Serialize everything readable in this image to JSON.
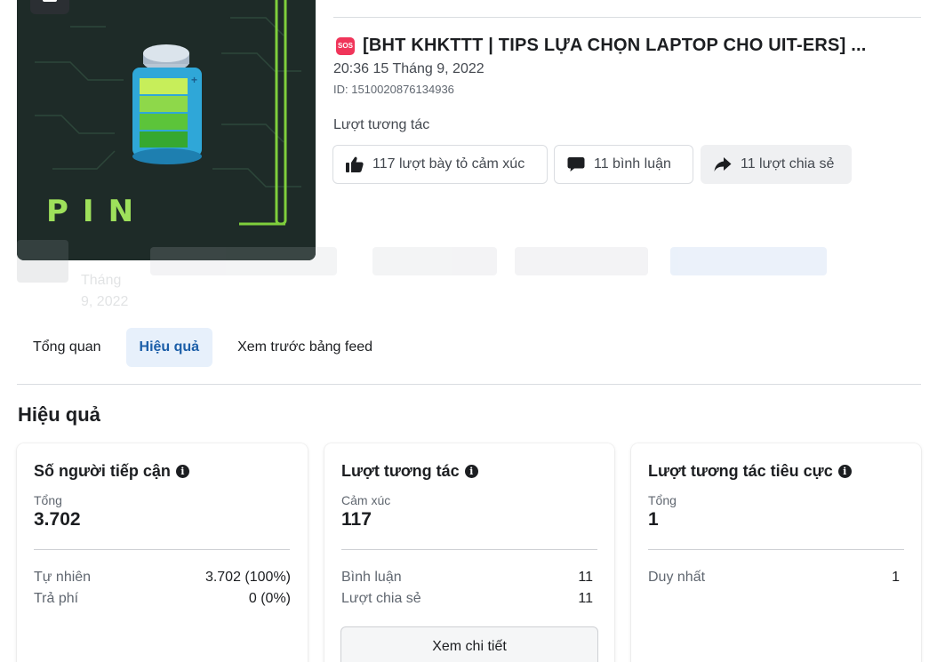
{
  "post": {
    "thumbnail_text": "PIN",
    "badge": "SOS",
    "title": "[BHT KHKTTT | TIPS LỰA CHỌN LAPTOP CHO UIT-ERS] ...",
    "date": "20:36 15 Tháng 9, 2022",
    "id_text": "ID: 1510020876134936",
    "interactions_label": "Lượt tương tác",
    "reactions_chip": "117 lượt bày tỏ cảm xúc",
    "comments_chip": "11 bình luận",
    "shares_chip": "11 lượt chia sẻ"
  },
  "faded_row": {
    "date_lines": [
      "Tháng",
      "9, 2022"
    ]
  },
  "tabs": [
    {
      "label": "Tổng quan",
      "active": false
    },
    {
      "label": "Hiệu quả",
      "active": true
    },
    {
      "label": "Xem trước bảng feed",
      "active": false
    }
  ],
  "section_heading": "Hiệu quả",
  "cards": {
    "reach": {
      "title": "Số người tiếp cận",
      "metric_label": "Tổng",
      "metric_value": "3.702",
      "rows": [
        {
          "label": "Tự nhiên",
          "value": "3.702 (100%)"
        },
        {
          "label": "Trả phí",
          "value": "0 (0%)"
        }
      ]
    },
    "engagement": {
      "title": "Lượt tương tác",
      "metric_label": "Cảm xúc",
      "metric_value": "117",
      "rows": [
        {
          "label": "Bình luận",
          "value": "11"
        },
        {
          "label": "Lượt chia sẻ",
          "value": "11"
        }
      ],
      "button": "Xem chi tiết"
    },
    "negative": {
      "title": "Lượt tương tác tiêu cực",
      "metric_label": "Tổng",
      "metric_value": "1",
      "rows": [
        {
          "label": "Duy nhất",
          "value": "1"
        }
      ]
    }
  },
  "colors": {
    "accent": "#1b5ea8",
    "active_tab_bg": "#e7f0fb",
    "badge_red": "#f0355a",
    "battery_green": "#9ee05b"
  }
}
